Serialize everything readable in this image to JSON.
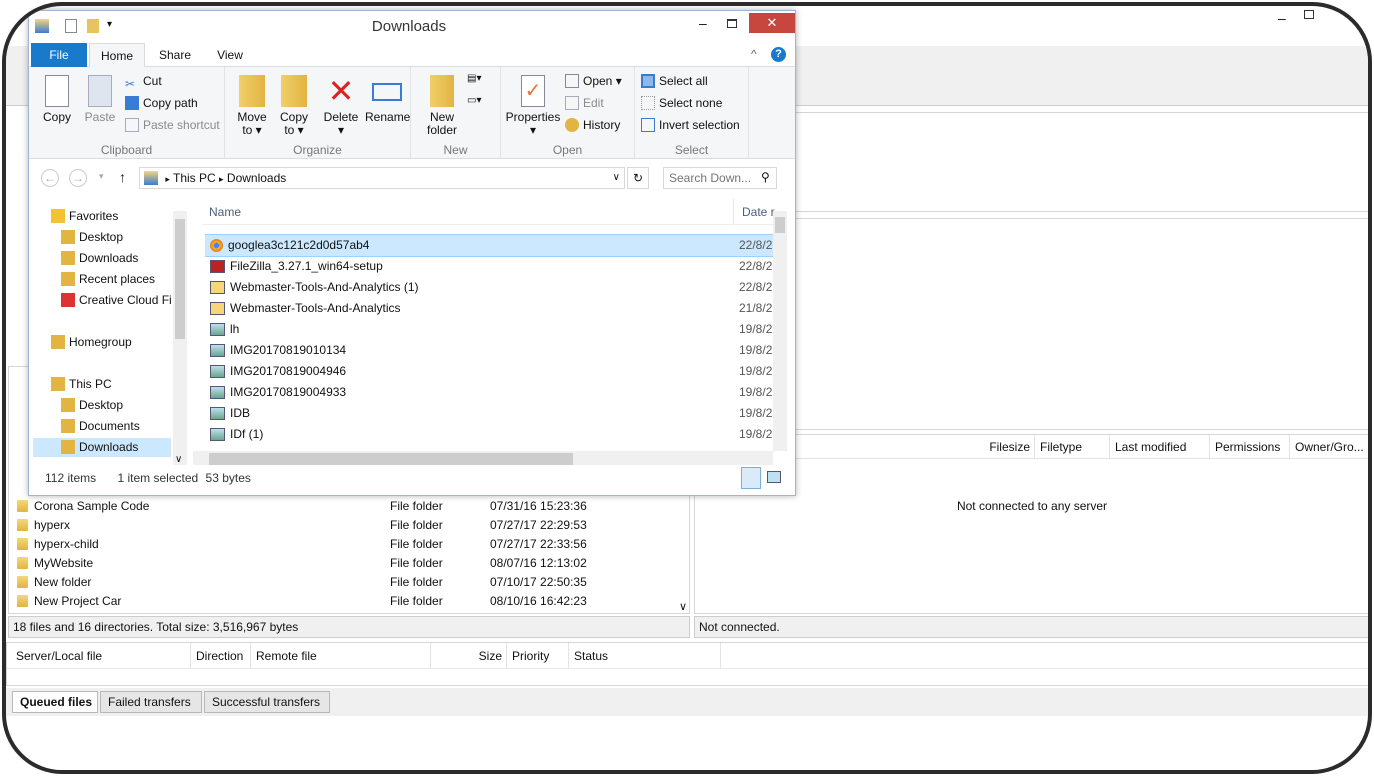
{
  "explorer": {
    "title": "Downloads",
    "ribbon_tabs": [
      "File",
      "Home",
      "Share",
      "View"
    ],
    "clipboard": {
      "copy": "Copy",
      "paste": "Paste",
      "cut": "Cut",
      "copy_path": "Copy path",
      "paste_shortcut": "Paste shortcut",
      "label": "Clipboard"
    },
    "organize": {
      "move_to": "Move to",
      "copy_to": "Copy to",
      "delete": "Delete",
      "rename": "Rename",
      "label": "Organize"
    },
    "new": {
      "new_folder": "New folder",
      "label": "New"
    },
    "open": {
      "properties": "Properties",
      "open": "Open",
      "edit": "Edit",
      "history": "History",
      "label": "Open"
    },
    "select": {
      "select_all": "Select all",
      "select_none": "Select none",
      "invert": "Invert selection",
      "label": "Select"
    },
    "breadcrumb": [
      "This PC",
      "Downloads"
    ],
    "search_placeholder": "Search Down...",
    "tree": [
      {
        "label": "Favorites",
        "level": 0,
        "icon": "star-icon"
      },
      {
        "label": "Desktop",
        "level": 1,
        "icon": "desktop-icon"
      },
      {
        "label": "Downloads",
        "level": 1,
        "icon": "downloads-folder-icon"
      },
      {
        "label": "Recent places",
        "level": 1,
        "icon": "recent-icon"
      },
      {
        "label": "Creative Cloud Fi",
        "level": 1,
        "icon": "creative-cloud-icon"
      },
      {
        "label": "",
        "level": 0,
        "icon": ""
      },
      {
        "label": "Homegroup",
        "level": 0,
        "icon": "homegroup-icon"
      },
      {
        "label": "",
        "level": 0,
        "icon": ""
      },
      {
        "label": "This PC",
        "level": 0,
        "icon": "computer-icon"
      },
      {
        "label": "Desktop",
        "level": 1,
        "icon": "desktop-icon"
      },
      {
        "label": "Documents",
        "level": 1,
        "icon": "documents-icon"
      },
      {
        "label": "Downloads",
        "level": 1,
        "icon": "downloads-folder-icon"
      }
    ],
    "columns": {
      "name": "Name",
      "date": "Date r"
    },
    "files": [
      {
        "name": "googlea3c121c2d0d57ab4",
        "date": "22/8/2",
        "icon": "chrome-icon",
        "selected": true
      },
      {
        "name": "FileZilla_3.27.1_win64-setup",
        "date": "22/8/2",
        "icon": "filezilla-icon"
      },
      {
        "name": "Webmaster-Tools-And-Analytics (1)",
        "date": "22/8/2",
        "icon": "package-icon"
      },
      {
        "name": "Webmaster-Tools-And-Analytics",
        "date": "21/8/2",
        "icon": "package-icon"
      },
      {
        "name": "lh",
        "date": "19/8/2",
        "icon": "image-icon"
      },
      {
        "name": "IMG20170819010134",
        "date": "19/8/2",
        "icon": "image-icon"
      },
      {
        "name": "IMG20170819004946",
        "date": "19/8/2",
        "icon": "image-icon"
      },
      {
        "name": "IMG20170819004933",
        "date": "19/8/2",
        "icon": "image-icon"
      },
      {
        "name": "IDB",
        "date": "19/8/2",
        "icon": "image-icon"
      },
      {
        "name": "IDf (1)",
        "date": "19/8/2",
        "icon": "image-icon"
      }
    ],
    "status": {
      "count": "112 items",
      "selected": "1 item selected",
      "size": "53 bytes"
    }
  },
  "local": {
    "rows": [
      {
        "name": "Corona Sample Code",
        "type": "File folder",
        "modified": "07/31/16 15:23:36"
      },
      {
        "name": "hyperx",
        "type": "File folder",
        "modified": "07/27/17 22:29:53"
      },
      {
        "name": "hyperx-child",
        "type": "File folder",
        "modified": "07/27/17 22:33:56"
      },
      {
        "name": "MyWebsite",
        "type": "File folder",
        "modified": "08/07/16 12:13:02"
      },
      {
        "name": "New folder",
        "type": "File folder",
        "modified": "07/10/17 22:50:35"
      },
      {
        "name": "New Project Car",
        "type": "File folder",
        "modified": "08/10/16 16:42:23"
      }
    ],
    "status": "18 files and 16 directories. Total size: 3,516,967 bytes"
  },
  "remote": {
    "columns": [
      "Filesize",
      "Filetype",
      "Last modified",
      "Permissions",
      "Owner/Gro..."
    ],
    "empty": "Not connected to any server",
    "status": "Not connected."
  },
  "queue": {
    "columns": [
      "Server/Local file",
      "Direction",
      "Remote file",
      "Size",
      "Priority",
      "Status"
    ],
    "tabs": [
      "Queued files",
      "Failed transfers",
      "Successful transfers"
    ]
  }
}
